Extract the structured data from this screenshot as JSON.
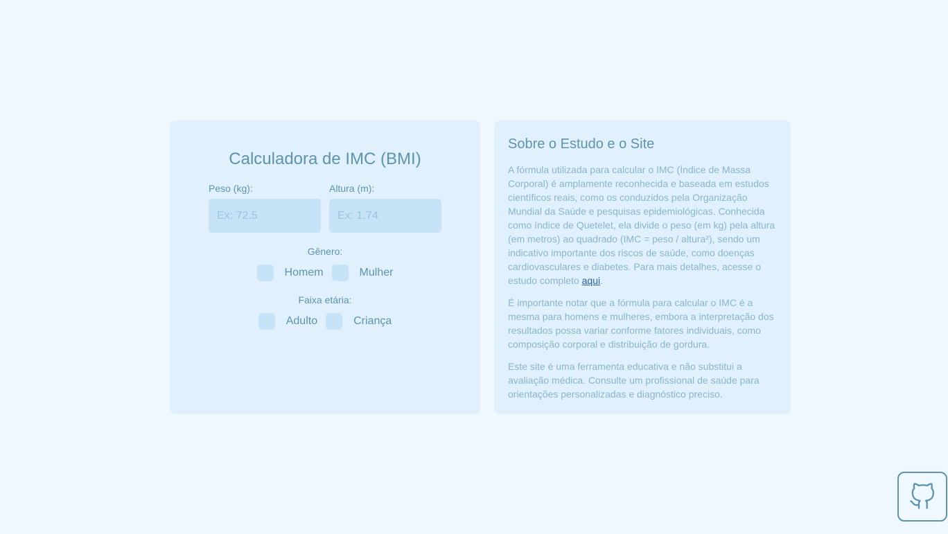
{
  "calculator": {
    "title": "Calculadora de IMC (BMI)",
    "weight": {
      "label": "Peso (kg):",
      "placeholder": "Ex: 72.5",
      "value": ""
    },
    "height": {
      "label": "Altura (m):",
      "placeholder": "Ex: 1.74",
      "value": ""
    },
    "gender": {
      "label": "Gênero:",
      "options": [
        "Homem",
        "Mulher"
      ]
    },
    "age_group": {
      "label": "Faixa etária:",
      "options": [
        "Adulto",
        "Criança"
      ]
    }
  },
  "info": {
    "title": "Sobre o Estudo e o Site",
    "p1": "A fórmula utilizada para calcular o IMC (Índice de Massa Corporal) é amplamente reconhecida e baseada em estudos científicos reais, como os conduzidos pela Organização Mundial da Saúde e pesquisas epidemiológicas. Conhecida como índice de Quetelet, ela divide o peso (em kg) pela altura (em metros) ao quadrado (IMC = peso / altura²), sendo um indicativo importante dos riscos de saúde, como doenças cardiovasculares e diabetes. Para mais detalhes, acesse o estudo completo ",
    "p1_link": "aqui",
    "p1_end": ".",
    "p2": "É importante notar que a fórmula para calcular o IMC é a mesma para homens e mulheres, embora a interpretação dos resultados possa variar conforme fatores individuais, como composição corporal e distribuição de gordura.",
    "p3": "Este site é uma ferramenta educativa e não substitui a avaliação médica. Consulte um profissional de saúde para orientações personalizadas e diagnóstico preciso."
  },
  "github_button": {
    "icon": "github-icon"
  },
  "colors": {
    "background": "#eef8fe",
    "card": "#e0f1fd",
    "input": "#c7e3f7",
    "primary_text": "#5d93ad",
    "secondary_text": "#8ab5cb",
    "link": "#2b5fa8"
  }
}
